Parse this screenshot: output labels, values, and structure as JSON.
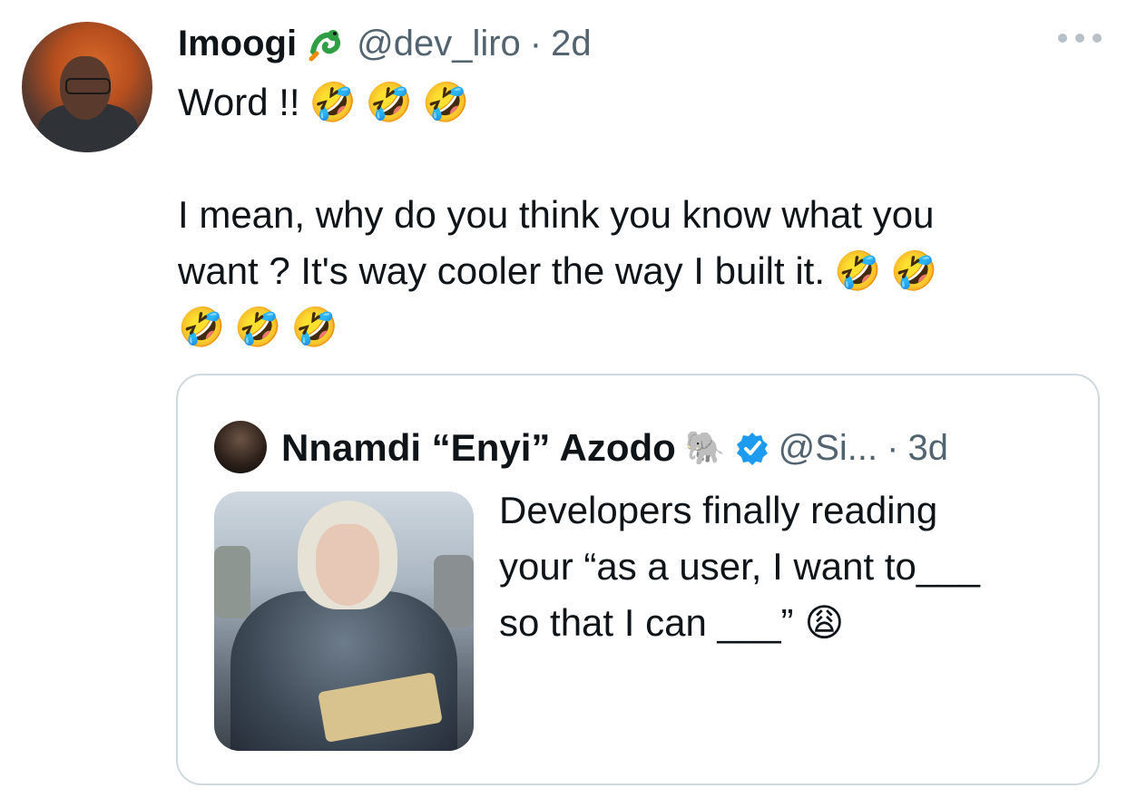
{
  "tweet": {
    "author": {
      "display_name": "Imoogi",
      "name_emoji": "🐉",
      "handle": "@dev_liro",
      "time": "2d",
      "separator": "·"
    },
    "more_icon": "more-horizontal-icon",
    "text_lines": [
      "Word !!",
      "",
      "I mean, why do you think you know what you",
      "want ? It's way cooler the way I built it."
    ],
    "emojis": {
      "line1": [
        "🤣",
        "🤣",
        "🤣"
      ],
      "line4": [
        "🤣",
        "🤣"
      ],
      "line5": [
        "🤣",
        "🤣",
        "🤣"
      ]
    }
  },
  "quoted_tweet": {
    "author": {
      "display_name": "Nnamdi “Enyi” Azodo",
      "name_emoji": "🐘",
      "verified_icon": "verified-badge-icon",
      "handle": "@Si...",
      "separator": "·",
      "time": "3d"
    },
    "text_lines": [
      "Developers finally reading",
      "your “as a user, I want to___",
      "so that I can ___”"
    ],
    "end_emoji": "😩"
  },
  "colors": {
    "text": "#0f1419",
    "muted": "#536471",
    "border": "#cfd9de",
    "verified": "#1d9bf0"
  }
}
